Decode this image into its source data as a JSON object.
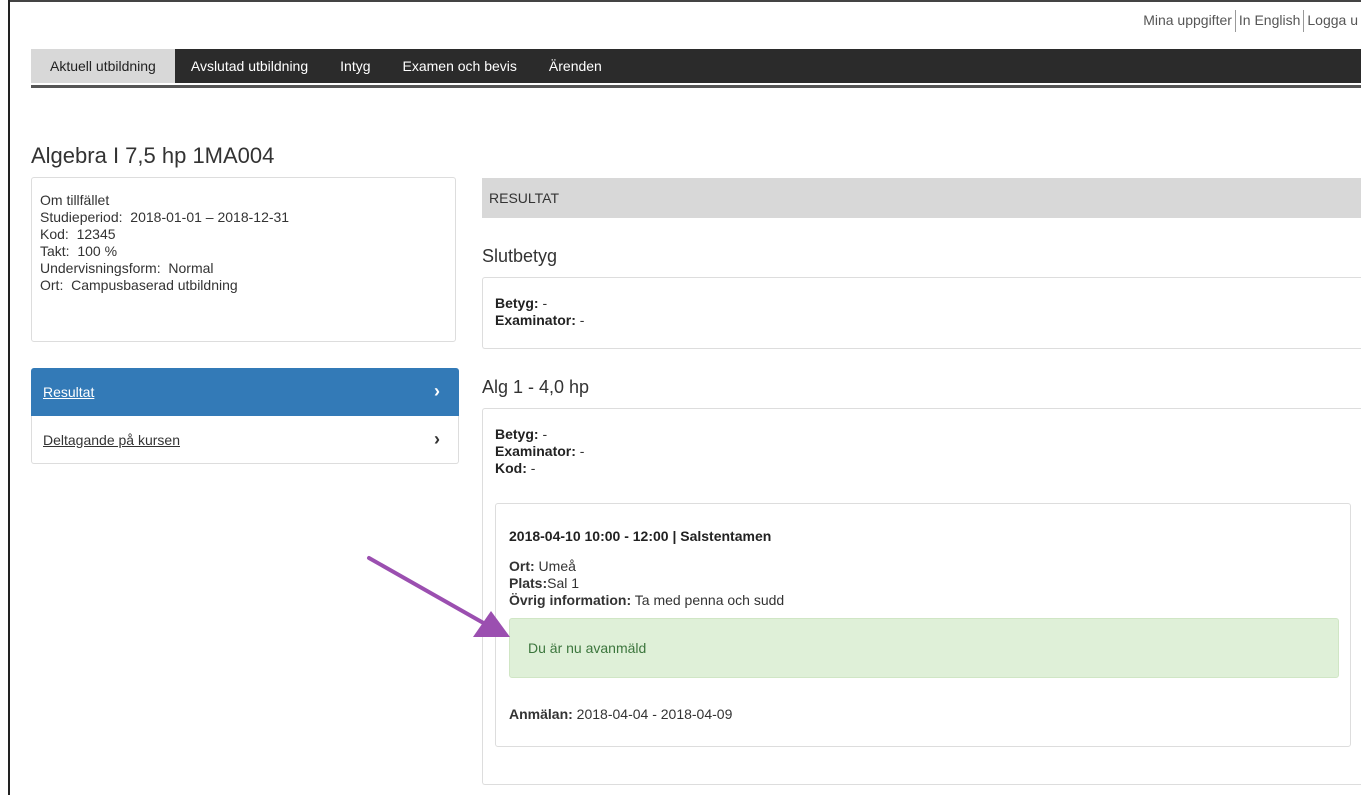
{
  "top_links": {
    "my_info": "Mina uppgifter",
    "english": "In English",
    "logout": "Logga u"
  },
  "nav": {
    "tabs": [
      {
        "label": "Aktuell utbildning",
        "active": true
      },
      {
        "label": "Avslutad utbildning"
      },
      {
        "label": "Intyg"
      },
      {
        "label": "Examen och bevis"
      },
      {
        "label": "Ärenden"
      }
    ]
  },
  "page_title": "Algebra I 7,5 hp 1MA004",
  "info": {
    "heading": "Om tillfället",
    "period_label": "Studieperiod:",
    "period_value": "2018-01-01 – 2018-12-31",
    "code_label": "Kod:",
    "code_value": "12345",
    "pace_label": "Takt:",
    "pace_value": "100 %",
    "form_label": "Undervisningsform:",
    "form_value": "Normal",
    "place_label": "Ort:",
    "place_value": "Campusbaserad utbildning"
  },
  "side_nav": {
    "items": [
      {
        "label": "Resultat"
      },
      {
        "label": "Deltagande på kursen"
      }
    ]
  },
  "results": {
    "header": "RESULTAT",
    "final": {
      "heading": "Slutbetyg",
      "grade_label": "Betyg:",
      "grade_value": " -",
      "examiner_label": "Examinator:",
      "examiner_value": " -"
    },
    "module": {
      "heading": "Alg 1 - 4,0 hp",
      "grade_label": "Betyg:",
      "grade_value": " -",
      "examiner_label": "Examinator:",
      "examiner_value": " -",
      "code_label": "Kod:",
      "code_value": " -"
    },
    "exam": {
      "title": "2018-04-10 10:00 - 12:00 | Salstentamen",
      "place_label": "Ort:",
      "place_value": " Umeå",
      "room_label": "Plats:",
      "room_value": "Sal 1",
      "info_label": "Övrig information:",
      "info_value": " Ta med penna och sudd",
      "alert": "Du är nu avanmäld",
      "reg_label": "Anmälan:",
      "reg_value": " 2018-04-04 - 2018-04-09"
    }
  },
  "colors": {
    "arrow": "#9b4fb0",
    "active_blue": "#337ab7",
    "success_bg": "#dff0d8",
    "success_text": "#3c763d",
    "navbar_bg": "#2b2b2b"
  }
}
